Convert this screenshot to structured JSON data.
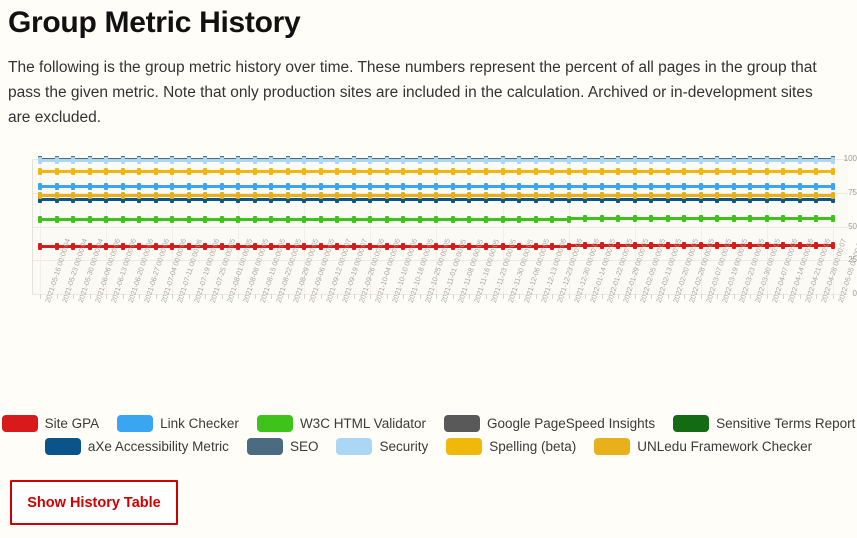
{
  "page": {
    "title": "Group Metric History",
    "intro": "The following is the group metric history over time. These numbers represent the percent of all pages in the group that pass the given metric. Note that only production sites are included in the calculation. Archived or in-development sites are excluded."
  },
  "actions": {
    "show_history_table_label": "Show History Table"
  },
  "chart_data": {
    "type": "line",
    "title": "",
    "xlabel": "",
    "ylabel": "",
    "ylim": [
      0,
      100
    ],
    "yticks": [
      0,
      25,
      50,
      75,
      100
    ],
    "grid": true,
    "legend_position": "bottom",
    "x": [
      "2021-05-16 00:00:04",
      "2021-05-23 00:00:04",
      "2021-05-30 00:00:04",
      "2021-06-06 00:00:06",
      "2021-06-13 00:00:06",
      "2021-06-20 00:00:06",
      "2021-06-27 00:00:06",
      "2021-07-04 00:00:06",
      "2021-07-11 00:00:06",
      "2021-07-19 00:00:06",
      "2021-07-25 00:00:05",
      "2021-08-01 00:00:05",
      "2021-08-08 00:00:05",
      "2021-08-15 00:00:05",
      "2021-08-22 00:00:05",
      "2021-08-29 00:00:05",
      "2021-09-06 00:00:05",
      "2021-09-12 00:00:07",
      "2021-09-19 00:00:07",
      "2021-09-26 00:00:06",
      "2021-10-04 00:00:06",
      "2021-10-10 00:00:06",
      "2021-10-18 00:00:05",
      "2021-10-25 00:00:05",
      "2021-11-01 00:00:05",
      "2021-11-08 00:00:05",
      "2021-11-16 00:00:05",
      "2021-11-23 00:00:05",
      "2021-11-30 00:00:05",
      "2021-12-06 00:00:05",
      "2021-12-13 00:00:06",
      "2021-12-23 00:00:06",
      "2021-12-30 00:00:06",
      "2022-01-14 00:00:05",
      "2022-01-22 00:00:05",
      "2022-01-29 00:00:05",
      "2022-02-05 00:00:05",
      "2022-02-13 00:00:05",
      "2022-02-20 00:00:05",
      "2022-02-28 00:00:05",
      "2022-03-07 00:00:05",
      "2022-03-19 00:00:05",
      "2022-03-23 00:00:05",
      "2022-03-30 00:00:05",
      "2022-04-07 00:00:06",
      "2022-04-14 00:00:06",
      "2022-04-21 00:00:06",
      "2022-04-28 00:00:07",
      "2022-05-05 00:00:07"
    ],
    "series": [
      {
        "name": "Site GPA",
        "color": "#d81a1a",
        "value": 35,
        "values": [
          35,
          35,
          35,
          35,
          35,
          35,
          35,
          35,
          35,
          35,
          35,
          35,
          35,
          35,
          35,
          35,
          35,
          35,
          35,
          35,
          35,
          35,
          35,
          35,
          35,
          35,
          35,
          35,
          35,
          35,
          35,
          35,
          35,
          36,
          36,
          36,
          36,
          36,
          36,
          36,
          36,
          36,
          36,
          36,
          36,
          36,
          36,
          36,
          36
        ]
      },
      {
        "name": "Link Checker",
        "color": "#3aa5f0",
        "value": 80,
        "values": [
          80,
          80,
          80,
          80,
          80,
          80,
          80,
          80,
          80,
          80,
          80,
          80,
          80,
          80,
          80,
          80,
          80,
          80,
          80,
          80,
          80,
          80,
          80,
          80,
          80,
          80,
          80,
          80,
          80,
          80,
          80,
          80,
          80,
          80,
          80,
          80,
          80,
          80,
          80,
          80,
          80,
          80,
          80,
          80,
          80,
          80,
          80,
          80,
          80
        ]
      },
      {
        "name": "W3C HTML Validator",
        "color": "#3ec31a",
        "value": 55,
        "values": [
          55,
          55,
          55,
          55,
          55,
          55,
          55,
          55,
          55,
          55,
          55,
          55,
          55,
          55,
          55,
          55,
          55,
          55,
          55,
          55,
          55,
          55,
          55,
          55,
          55,
          55,
          55,
          55,
          55,
          55,
          55,
          55,
          55,
          56,
          56,
          56,
          56,
          56,
          56,
          56,
          56,
          56,
          56,
          56,
          56,
          56,
          56,
          56,
          56
        ]
      },
      {
        "name": "Google PageSpeed Insights",
        "color": "#595959",
        "value": 100,
        "values": [
          100,
          100,
          100,
          100,
          100,
          100,
          100,
          100,
          100,
          100,
          100,
          100,
          100,
          100,
          100,
          100,
          100,
          100,
          100,
          100,
          100,
          100,
          100,
          100,
          100,
          100,
          100,
          100,
          100,
          100,
          100,
          100,
          100,
          100,
          100,
          100,
          100,
          100,
          100,
          100,
          100,
          100,
          100,
          100,
          100,
          100,
          100,
          100,
          100
        ]
      },
      {
        "name": "Sensitive Terms Report",
        "color": "#136b13",
        "value": 100,
        "values": [
          100,
          100,
          100,
          100,
          100,
          100,
          100,
          100,
          100,
          100,
          100,
          100,
          100,
          100,
          100,
          100,
          100,
          100,
          100,
          100,
          100,
          100,
          100,
          100,
          100,
          100,
          100,
          100,
          100,
          100,
          100,
          100,
          100,
          100,
          100,
          100,
          100,
          100,
          100,
          100,
          100,
          100,
          100,
          100,
          100,
          100,
          100,
          100,
          100
        ]
      },
      {
        "name": "aXe Accessibility Metric",
        "color": "#0a5489",
        "value": 70,
        "values": [
          70,
          70,
          70,
          70,
          70,
          70,
          70,
          70,
          70,
          70,
          70,
          70,
          70,
          70,
          70,
          70,
          70,
          70,
          70,
          70,
          70,
          70,
          70,
          70,
          70,
          70,
          70,
          70,
          70,
          70,
          70,
          70,
          70,
          70,
          70,
          70,
          70,
          70,
          70,
          70,
          70,
          70,
          70,
          70,
          70,
          70,
          70,
          70,
          70
        ]
      },
      {
        "name": "SEO",
        "color": "#4a6madmin",
        "value": 100,
        "values": [
          100,
          100,
          100,
          100,
          100,
          100,
          100,
          100,
          100,
          100,
          100,
          100,
          100,
          100,
          100,
          100,
          100,
          100,
          100,
          100,
          100,
          100,
          100,
          100,
          100,
          100,
          100,
          100,
          100,
          100,
          100,
          100,
          100,
          100,
          100,
          100,
          100,
          100,
          100,
          100,
          100,
          100,
          100,
          100,
          100,
          100,
          100,
          100,
          100
        ]
      },
      {
        "name": "Security",
        "color": "#abd7f5",
        "value": 99,
        "values": [
          99,
          99,
          99,
          99,
          99,
          99,
          99,
          99,
          99,
          99,
          99,
          99,
          99,
          99,
          99,
          99,
          99,
          99,
          99,
          99,
          99,
          99,
          99,
          99,
          99,
          99,
          99,
          99,
          99,
          99,
          99,
          99,
          99,
          99,
          99,
          99,
          99,
          99,
          99,
          99,
          99,
          99,
          99,
          99,
          99,
          99,
          99,
          99,
          99
        ]
      },
      {
        "name": "Spelling (beta)",
        "color": "#efb80b",
        "value": 91,
        "values": [
          91,
          91,
          91,
          91,
          91,
          91,
          91,
          91,
          91,
          91,
          91,
          91,
          91,
          91,
          91,
          91,
          91,
          91,
          91,
          91,
          91,
          91,
          91,
          91,
          91,
          91,
          91,
          91,
          91,
          91,
          91,
          91,
          91,
          91,
          91,
          91,
          91,
          91,
          91,
          91,
          91,
          91,
          91,
          91,
          91,
          91,
          91,
          91,
          91
        ]
      },
      {
        "name": "UNLedu Framework Checker",
        "color": "#e8b11c",
        "value": 73,
        "values": [
          73,
          73,
          73,
          73,
          73,
          73,
          73,
          73,
          73,
          73,
          73,
          73,
          73,
          73,
          73,
          73,
          73,
          73,
          73,
          73,
          73,
          73,
          73,
          73,
          73,
          73,
          73,
          73,
          73,
          73,
          73,
          73,
          73,
          73,
          73,
          73,
          73,
          73,
          73,
          73,
          73,
          73,
          73,
          73,
          73,
          73,
          73,
          73,
          73
        ]
      }
    ],
    "legend": [
      {
        "label": "Site GPA",
        "color": "#d81a1a"
      },
      {
        "label": "Link Checker",
        "color": "#3aa5f0"
      },
      {
        "label": "W3C HTML Validator",
        "color": "#3ec31a"
      },
      {
        "label": "Google PageSpeed Insights",
        "color": "#595959"
      },
      {
        "label": "Sensitive Terms Report",
        "color": "#136b13"
      },
      {
        "label": "aXe Accessibility Metric",
        "color": "#0a5489"
      },
      {
        "label": "SEO",
        "color": "#4a6b80"
      },
      {
        "label": "Security",
        "color": "#abd7f5"
      },
      {
        "label": "Spelling (beta)",
        "color": "#efb80b"
      },
      {
        "label": "UNLedu Framework Checker",
        "color": "#e8b11c"
      }
    ]
  }
}
